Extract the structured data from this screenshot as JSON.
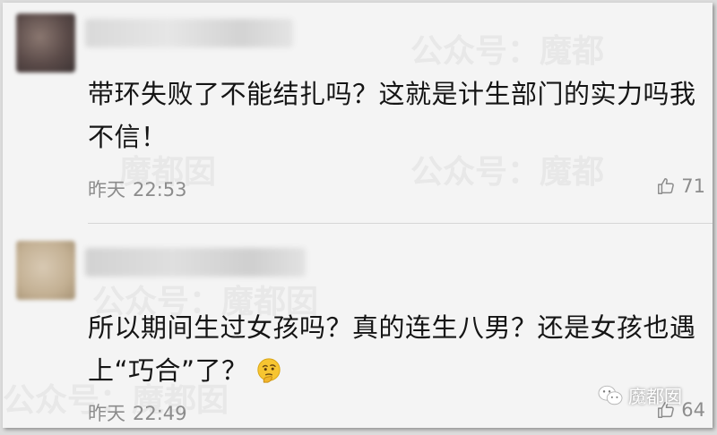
{
  "comments": [
    {
      "text": "带环失败了不能结扎吗？这就是计生部门的实力吗我不信！",
      "date": "昨天",
      "time": "22:53",
      "likes": "71"
    },
    {
      "text": "所以期间生过女孩吗？真的连生八男？还是女孩也遇上“巧合”了？",
      "date": "昨天",
      "time": "22:49",
      "likes": "64",
      "emoji_icon": "thinking-face-icon"
    }
  ],
  "watermark": {
    "line1": "公众号：魔都",
    "line2": "魔都囡",
    "line3": "公众号：魔都囡"
  },
  "badge": {
    "label": "魔都囡",
    "icon": "wechat-icon"
  }
}
